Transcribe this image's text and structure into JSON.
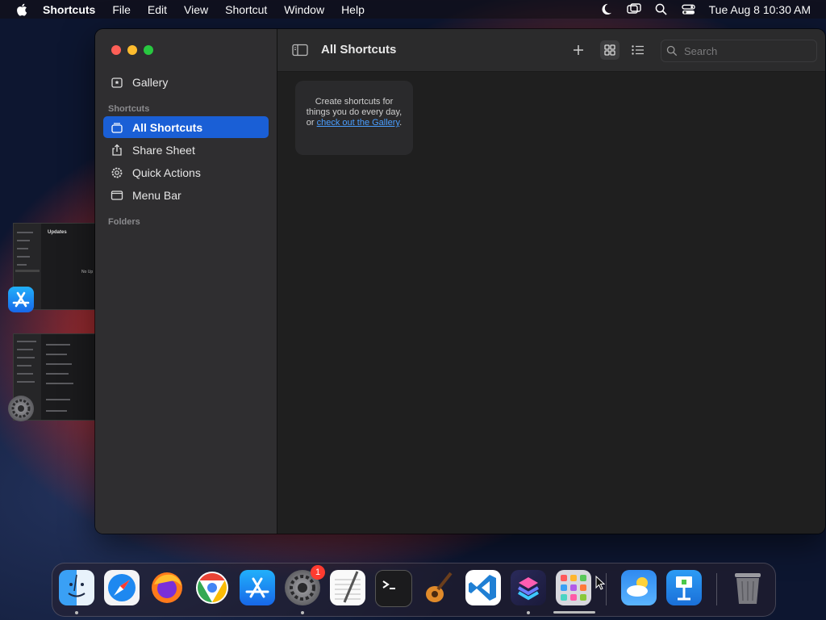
{
  "menubar": {
    "app_name": "Shortcuts",
    "items": [
      "File",
      "Edit",
      "View",
      "Shortcut",
      "Window",
      "Help"
    ],
    "clock": "Tue Aug 8  10:30 AM",
    "status_icons": [
      "moon-icon",
      "screen-mirroring-icon",
      "spotlight-search-icon",
      "control-center-icon"
    ]
  },
  "sidebar": {
    "gallery_label": "Gallery",
    "section_shortcuts": "Shortcuts",
    "items": [
      {
        "label": "All Shortcuts",
        "icon": "stack-icon",
        "active": true
      },
      {
        "label": "Share Sheet",
        "icon": "share-icon",
        "active": false
      },
      {
        "label": "Quick Actions",
        "icon": "gear-icon",
        "active": false
      },
      {
        "label": "Menu Bar",
        "icon": "menubar-icon",
        "active": false
      }
    ],
    "section_folders": "Folders"
  },
  "toolbar": {
    "title": "All Shortcuts",
    "search_placeholder": "Search"
  },
  "hint": {
    "text_before": "Create shortcuts for things you do every day, or ",
    "link": "check out the Gallery",
    "text_after": "."
  },
  "stage": {
    "thumb1_title": "Updates",
    "thumb1_msg": "No Up"
  },
  "dock": {
    "apps": [
      "Finder",
      "Safari",
      "Firefox",
      "Chrome",
      "App Store",
      "System Settings",
      "TextEdit",
      "Terminal",
      "GarageBand",
      "Visual Studio Code",
      "Shortcuts",
      "Launchpad",
      "Weather",
      "Keynote",
      "Trash"
    ],
    "settings_badge": "1"
  },
  "colors": {
    "accent": "#1a5fd6",
    "link": "#4a9eff",
    "badge": "#ff3b30"
  }
}
